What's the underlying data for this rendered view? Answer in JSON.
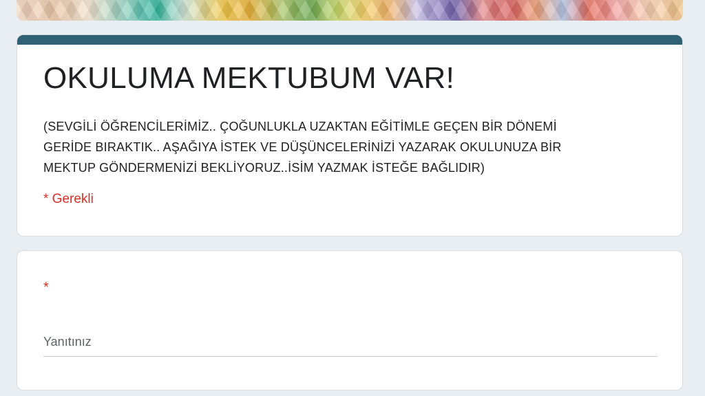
{
  "form": {
    "title": "OKULUMA MEKTUBUM VAR!",
    "description": "(SEVGİLİ ÖĞRENCİLERİMİZ.. ÇOĞUNLUKLA UZAKTAN EĞİTİMLE GEÇEN BİR DÖNEMİ\nGERİDE BIRAKTIK.. AŞAĞIYA İSTEK VE DÜŞÜNCELERİNİZİ YAZARAK OKULUNUZA BİR\nMEKTUP GÖNDERMENİZİ BEKLİYORUZ..İSİM YAZMAK İSTEĞE BAĞLIDIR)",
    "required_note": "* Gerekli",
    "accent_color": "#2f6074",
    "required_color": "#d93025"
  },
  "question": {
    "required_marker": "*",
    "answer_placeholder": "Yanıtınız",
    "answer_value": ""
  }
}
